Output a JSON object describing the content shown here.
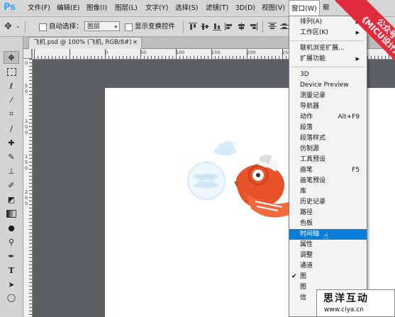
{
  "app": {
    "logo": "Ps"
  },
  "menubar": [
    "文件(F)",
    "编辑(E)",
    "图像(I)",
    "图层(L)",
    "文字(Y)",
    "选择(S)",
    "滤镜(T)",
    "3D(D)",
    "视图(V)",
    "窗口(W)",
    "帮"
  ],
  "options": {
    "auto_select_label": "自动选择：",
    "layer_select_value": "图层",
    "show_transform_label": "显示变换控件"
  },
  "document_tab": {
    "title": "飞机.psd @ 100% (飞机, RGB/8#)",
    "close": "×"
  },
  "rulers": {
    "top_labels": [
      "0",
      "50",
      "100",
      "150",
      "200",
      "250",
      "300",
      "350",
      "400",
      "450",
      "500"
    ],
    "left_labels": [
      "0",
      "5",
      "0",
      "1",
      "0",
      "0",
      "1",
      "5",
      "0",
      "2",
      "0",
      "0"
    ]
  },
  "window_menu": {
    "items": [
      {
        "label": "排列(A)",
        "submenu": true
      },
      {
        "label": "工作区(K)",
        "submenu": true
      },
      {
        "sep": true
      },
      {
        "label": "联机浏览扩展..."
      },
      {
        "label": "扩展功能",
        "submenu": true
      },
      {
        "sep": true
      },
      {
        "label": "3D"
      },
      {
        "label": "Device Preview"
      },
      {
        "label": "测量记录"
      },
      {
        "label": "导航器"
      },
      {
        "label": "动作",
        "shortcut": "Alt+F9"
      },
      {
        "label": "段落"
      },
      {
        "label": "段落样式"
      },
      {
        "label": "仿制源"
      },
      {
        "label": "工具预设"
      },
      {
        "label": "画笔",
        "shortcut": "F5"
      },
      {
        "label": "画笔预设"
      },
      {
        "label": "库"
      },
      {
        "label": "历史记录"
      },
      {
        "label": "路径"
      },
      {
        "label": "色板"
      },
      {
        "label": "时间轴",
        "highlighted": true
      },
      {
        "label": "属性"
      },
      {
        "label": "调整"
      },
      {
        "label": "通道"
      },
      {
        "label": "图",
        "checked": true
      },
      {
        "label": "图"
      },
      {
        "label": "信"
      }
    ]
  },
  "banner": {
    "line1": "公众号",
    "line2": "《MICU设计》"
  },
  "watermark": {
    "title": "思洋互动",
    "url": "www.ciya.cn"
  },
  "colors": {
    "highlight": "#0d7ed8",
    "banner_red": "#e02c3d",
    "plane_orange": "#e8532a",
    "cloud_blue": "#d6ecfb"
  }
}
